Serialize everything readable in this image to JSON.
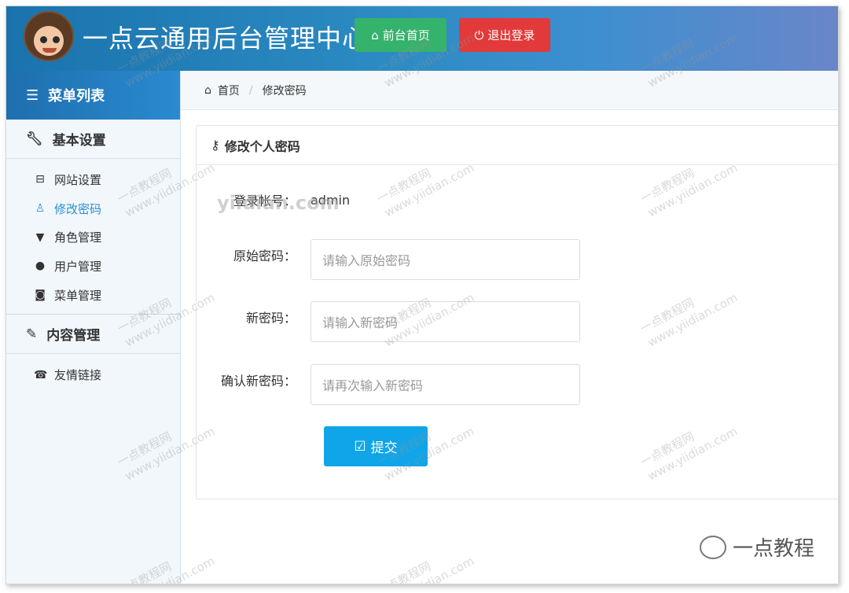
{
  "header": {
    "title": "一点云通用后台管理中心",
    "home_button": "前台首页",
    "logout_button": "退出登录"
  },
  "sidebar": {
    "menu_title": "菜单列表",
    "groups": [
      {
        "title": "基本设置",
        "items": [
          {
            "label": "网站设置",
            "icon": "hdd-icon"
          },
          {
            "label": "修改密码",
            "icon": "user-key-icon",
            "active": true
          },
          {
            "label": "角色管理",
            "icon": "filter-icon"
          },
          {
            "label": "用户管理",
            "icon": "user-icon"
          },
          {
            "label": "菜单管理",
            "icon": "camera-icon"
          }
        ]
      },
      {
        "title": "内容管理",
        "items": [
          {
            "label": "友情链接",
            "icon": "phone-icon"
          }
        ]
      }
    ]
  },
  "breadcrumb": {
    "home": "首页",
    "current": "修改密码"
  },
  "panel": {
    "title": "修改个人密码",
    "account_label": "登录帐号：",
    "account_value": "admin",
    "old_password_label": "原始密码：",
    "old_password_placeholder": "请输入原始密码",
    "new_password_label": "新密码：",
    "new_password_placeholder": "请输入新密码",
    "confirm_password_label": "确认新密码：",
    "confirm_password_placeholder": "请再次输入新密码",
    "submit_label": "提交"
  },
  "watermark": {
    "site_text": "一点教程网",
    "url_text": "www.yiidian.com",
    "overlay_text": "yiidian.com",
    "brand": "一点教程"
  },
  "colors": {
    "header_blue": "#2c8bc2",
    "home_green": "#35b26c",
    "logout_red": "#e23a3a",
    "submit_blue": "#10a5e8",
    "active_link": "#2b8fc9"
  }
}
